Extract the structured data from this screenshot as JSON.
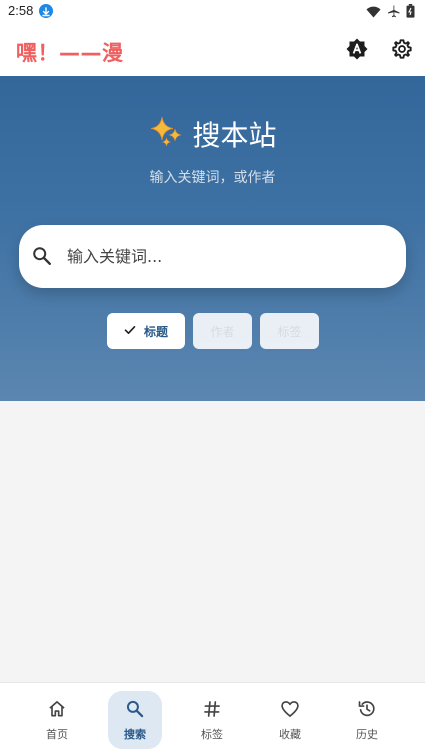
{
  "status_bar": {
    "time": "2:58",
    "icons": [
      "download-icon",
      "wifi-icon",
      "airplane-icon",
      "battery-icon"
    ]
  },
  "app_bar": {
    "title": "嘿！——漫",
    "title_color": "#f06060",
    "actions": [
      "translate-icon",
      "settings-icon"
    ]
  },
  "hero": {
    "icon": "sparkles-icon",
    "title": "搜本站",
    "subtitle": "输入关键词，或作者",
    "gradient": [
      "#33669a",
      "#5b86b0"
    ]
  },
  "search": {
    "placeholder": "输入关键词...",
    "value": ""
  },
  "filters": {
    "chips": [
      {
        "label": "标题",
        "selected": true
      },
      {
        "label": "作者",
        "selected": false
      },
      {
        "label": "标签",
        "selected": false
      }
    ]
  },
  "bottom_nav": {
    "items": [
      {
        "label": "首页",
        "icon": "home-icon",
        "active": false
      },
      {
        "label": "搜索",
        "icon": "search-icon",
        "active": true
      },
      {
        "label": "标签",
        "icon": "hashtag-icon",
        "active": false
      },
      {
        "label": "收藏",
        "icon": "heart-icon",
        "active": false
      },
      {
        "label": "历史",
        "icon": "history-icon",
        "active": false
      }
    ]
  },
  "colors": {
    "accent": "#2b5a8a",
    "active_nav_bg": "#dde8f2",
    "page_bg": "#f4f4f5"
  }
}
